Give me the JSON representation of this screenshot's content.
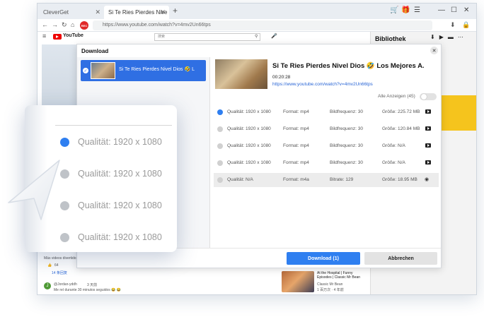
{
  "browser": {
    "tabs": [
      {
        "label": "CleverGet"
      },
      {
        "label": "Si Te Ries Pierdes Nive"
      }
    ],
    "url": "https://www.youtube.com/watch?v=4mv2Un66tps",
    "rec_badge": "REC"
  },
  "youtube": {
    "logo_text": "YouTube",
    "search_placeholder": "搜索"
  },
  "library": {
    "title": "Bibliothek"
  },
  "dialog": {
    "title": "Download",
    "close_label": "✕",
    "item_title": "Si Te Ries Pierdes Nivel Dios 🤣 L",
    "video": {
      "title": "Si Te Ries Pierdes Nivel Dios 🤣 Los Mejores A.",
      "duration": "00:20:28",
      "url": "https://www.youtube.com/watch?v=4mv2Un66tps"
    },
    "show_all_label": "Alle Anzeigen (45)",
    "show_all_enabled": false,
    "formats": [
      {
        "quality": "Qualität: 1920 x 1080",
        "format": "Format: mp4",
        "rate": "Bildfrequenz: 30",
        "size": "Größe: 225.72 MB",
        "selected": true
      },
      {
        "quality": "Qualität: 1920 x 1080",
        "format": "Format: mp4",
        "rate": "Bildfrequenz: 30",
        "size": "Größe: 120.84 MB",
        "selected": false
      },
      {
        "quality": "Qualität: 1920 x 1080",
        "format": "Format: mp4",
        "rate": "Bildfrequenz: 30",
        "size": "Größe: N/A",
        "selected": false
      },
      {
        "quality": "Qualität: 1920 x 1080",
        "format": "Format: mp4",
        "rate": "Bildfrequenz: 30",
        "size": "Größe: N/A",
        "selected": false
      },
      {
        "quality": "Qualität: N/A",
        "format": "Format: m4a",
        "rate": "Bitrate: 129",
        "size": "Größe: 18.95 MB",
        "selected": false
      }
    ],
    "download_button": "Download (1)",
    "cancel_button": "Abbrechen"
  },
  "page_behind": {
    "comment_text": "Más videos divertidos",
    "likes": "64",
    "replies": "14 条回复",
    "commenter": "@Jordan-yddh",
    "commenter_time": "3 天前",
    "comment2": "Me reí durante 30 minutos seguidos 😂 😂",
    "avatar_letter": "J",
    "sidebar_video_title": "At the Hospital | Funny Episodes | Classic Mr Bean",
    "sidebar_video_channel": "Classic Mr Bean",
    "sidebar_video_meta": "1 百万次 · 4 年前"
  },
  "zoom": {
    "rows": [
      {
        "label": "Qualität: 1920 x 1080",
        "selected": true
      },
      {
        "label": "Qualität: 1920 x 1080",
        "selected": false
      },
      {
        "label": "Qualität: 1920 x 1080",
        "selected": false
      },
      {
        "label": "Qualität: 1920 x 1080",
        "selected": false
      }
    ]
  },
  "colors": {
    "accent": "#2f7ff0",
    "dialog_item": "#2f6fe3",
    "youtube_red": "#e00000",
    "rec_red": "#e02828",
    "link": "#2a66d6",
    "library_tile": "#f5c41d"
  }
}
